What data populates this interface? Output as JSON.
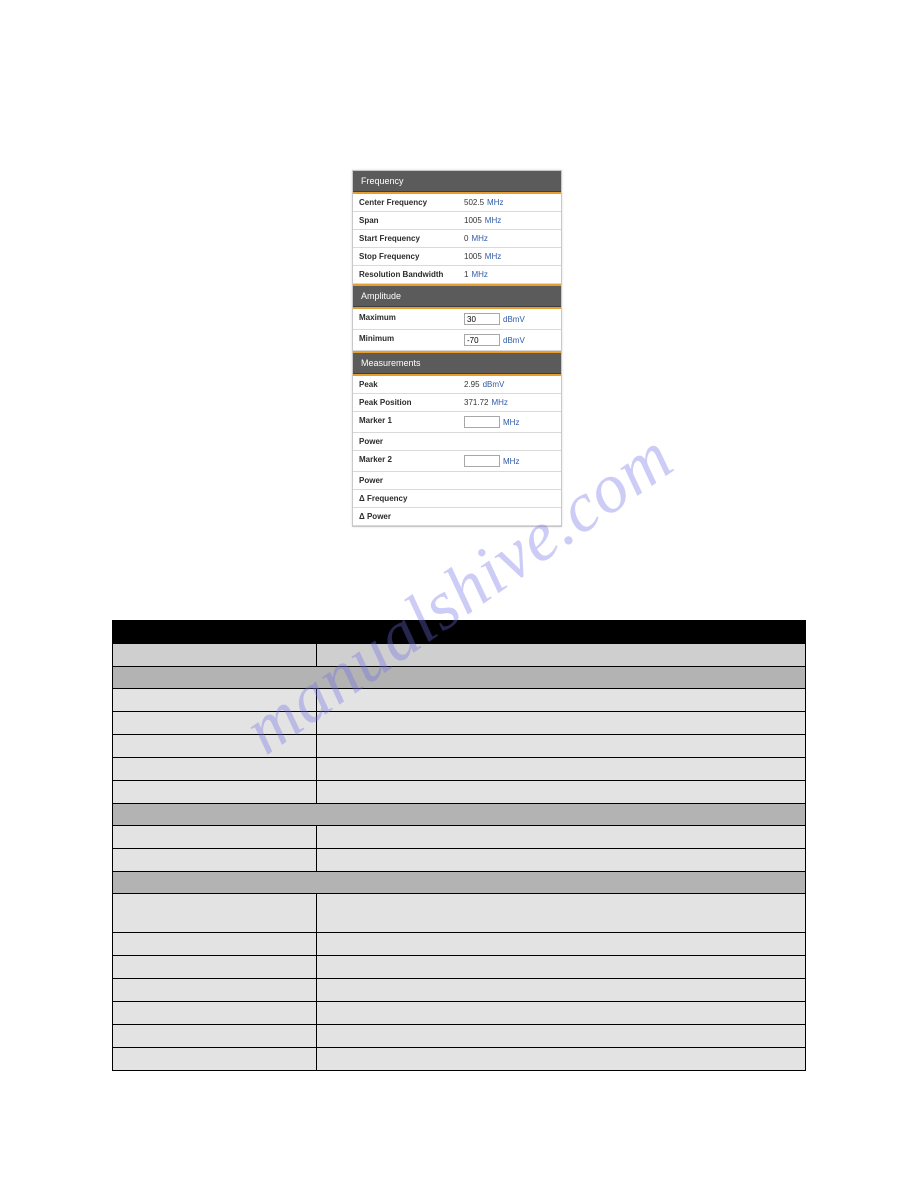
{
  "watermark": "manualshive.com",
  "figure": {
    "sections": [
      {
        "title": "Frequency",
        "rows": [
          {
            "label": "Center Frequency",
            "num": "502.5",
            "unit": "MHz",
            "type": "text"
          },
          {
            "label": "Span",
            "num": "1005",
            "unit": "MHz",
            "type": "text"
          },
          {
            "label": "Start Frequency",
            "num": "0",
            "unit": "MHz",
            "type": "text"
          },
          {
            "label": "Stop Frequency",
            "num": "1005",
            "unit": "MHz",
            "type": "text"
          },
          {
            "label": "Resolution Bandwidth",
            "num": "1",
            "unit": "MHz",
            "type": "text"
          }
        ]
      },
      {
        "title": "Amplitude",
        "rows": [
          {
            "label": "Maximum",
            "value": "30",
            "unit": "dBmV",
            "type": "input"
          },
          {
            "label": "Minimum",
            "value": "-70",
            "unit": "dBmV",
            "type": "input"
          }
        ]
      },
      {
        "title": "Measurements",
        "rows": [
          {
            "label": "Peak",
            "num": "2.95",
            "unit": "dBmV",
            "type": "text"
          },
          {
            "label": "Peak Position",
            "num": "371.72",
            "unit": "MHz",
            "type": "text"
          },
          {
            "label": "Marker 1",
            "value": "",
            "unit": "MHz",
            "type": "input"
          },
          {
            "label": "Power",
            "type": "empty"
          },
          {
            "label": "Marker 2",
            "value": "",
            "unit": "MHz",
            "type": "input"
          },
          {
            "label": "Power",
            "type": "empty"
          },
          {
            "label": "Δ Frequency",
            "type": "empty"
          },
          {
            "label": "Δ Power",
            "type": "empty"
          }
        ]
      }
    ]
  },
  "lower_table": {
    "blocks": [
      {
        "kind": "head"
      },
      {
        "kind": "subhead"
      },
      {
        "kind": "section"
      },
      {
        "kind": "row"
      },
      {
        "kind": "row"
      },
      {
        "kind": "row"
      },
      {
        "kind": "row"
      },
      {
        "kind": "row"
      },
      {
        "kind": "section"
      },
      {
        "kind": "row"
      },
      {
        "kind": "row"
      },
      {
        "kind": "section"
      },
      {
        "kind": "row",
        "tall": true
      },
      {
        "kind": "row"
      },
      {
        "kind": "row"
      },
      {
        "kind": "row"
      },
      {
        "kind": "row"
      },
      {
        "kind": "row"
      },
      {
        "kind": "row"
      }
    ]
  }
}
